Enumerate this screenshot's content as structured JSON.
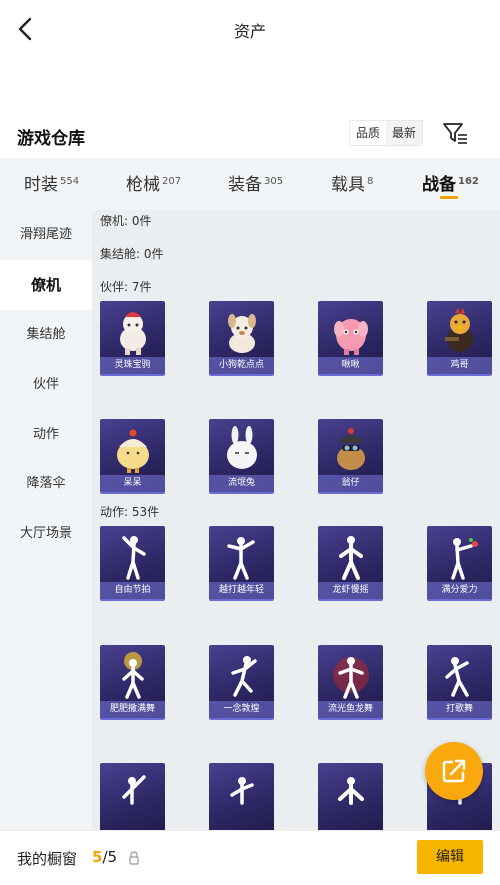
{
  "header": {
    "title": "资产"
  },
  "section": {
    "title": "游戏仓库",
    "sort_options": [
      "品质",
      "最新"
    ]
  },
  "tabs": [
    {
      "label": "时装",
      "count": "554"
    },
    {
      "label": "枪械",
      "count": "207"
    },
    {
      "label": "装备",
      "count": "305"
    },
    {
      "label": "载具",
      "count": "8"
    },
    {
      "label": "战备",
      "count": "162",
      "active": true
    }
  ],
  "sidebar": [
    {
      "label": "滑翔尾迹"
    },
    {
      "label": "僚机",
      "active": true
    },
    {
      "label": "集结舱"
    },
    {
      "label": "伙伴"
    },
    {
      "label": "动作"
    },
    {
      "label": "降落伞"
    },
    {
      "label": "大厅场景"
    }
  ],
  "groups": {
    "liaoji": "僚机: 0件",
    "jijiecang": "集结舱: 0件",
    "huoban": "伙伴: 7件",
    "dongzuo": "动作: 53件"
  },
  "partners": [
    "灵珠宝驹",
    "小狗乾点点",
    "啾啾",
    "鸡哥",
    "呆呆",
    "流氓兔",
    "翁仔"
  ],
  "actions": [
    "自由节拍",
    "越打越年轻",
    "龙虾慢摇",
    "满分爱力",
    "肥肥撒满舞",
    "一念敦煌",
    "流光鱼龙舞",
    "打歌舞"
  ],
  "bottom": {
    "showcase_label": "我的橱窗",
    "current": "5",
    "total": "/5",
    "edit_label": "编辑"
  },
  "colors": {
    "accent": "#f5a300",
    "card_bg": "#2e2866"
  }
}
